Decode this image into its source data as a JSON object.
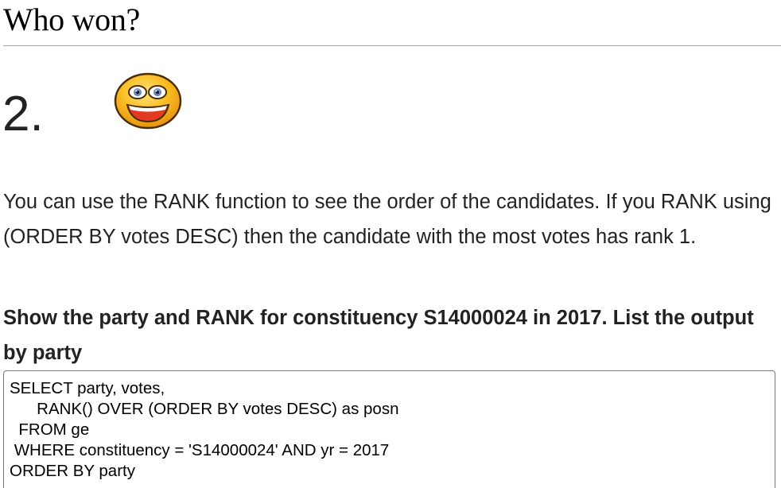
{
  "section": {
    "title": "Who won?"
  },
  "question": {
    "number": "2.",
    "icon": "grinning-smiley-icon",
    "explanation": "You can use the RANK function to see the order of the candidates. If you RANK using (ORDER BY votes DESC) then the candidate with the most votes has rank 1.",
    "task": "Show the party and RANK for constituency S14000024 in 2017. List the output by party"
  },
  "editor": {
    "lines": [
      "SELECT party, votes,",
      "      RANK() OVER (ORDER BY votes DESC) as posn",
      "  FROM ge",
      " WHERE constituency = 'S14000024' AND yr = 2017",
      "ORDER BY party"
    ]
  },
  "colors": {
    "smiley_face": "#f7b51c",
    "smiley_outline": "#4a2d05",
    "mouth": "#e23b22",
    "eye_iris": "#6a8ac7"
  }
}
